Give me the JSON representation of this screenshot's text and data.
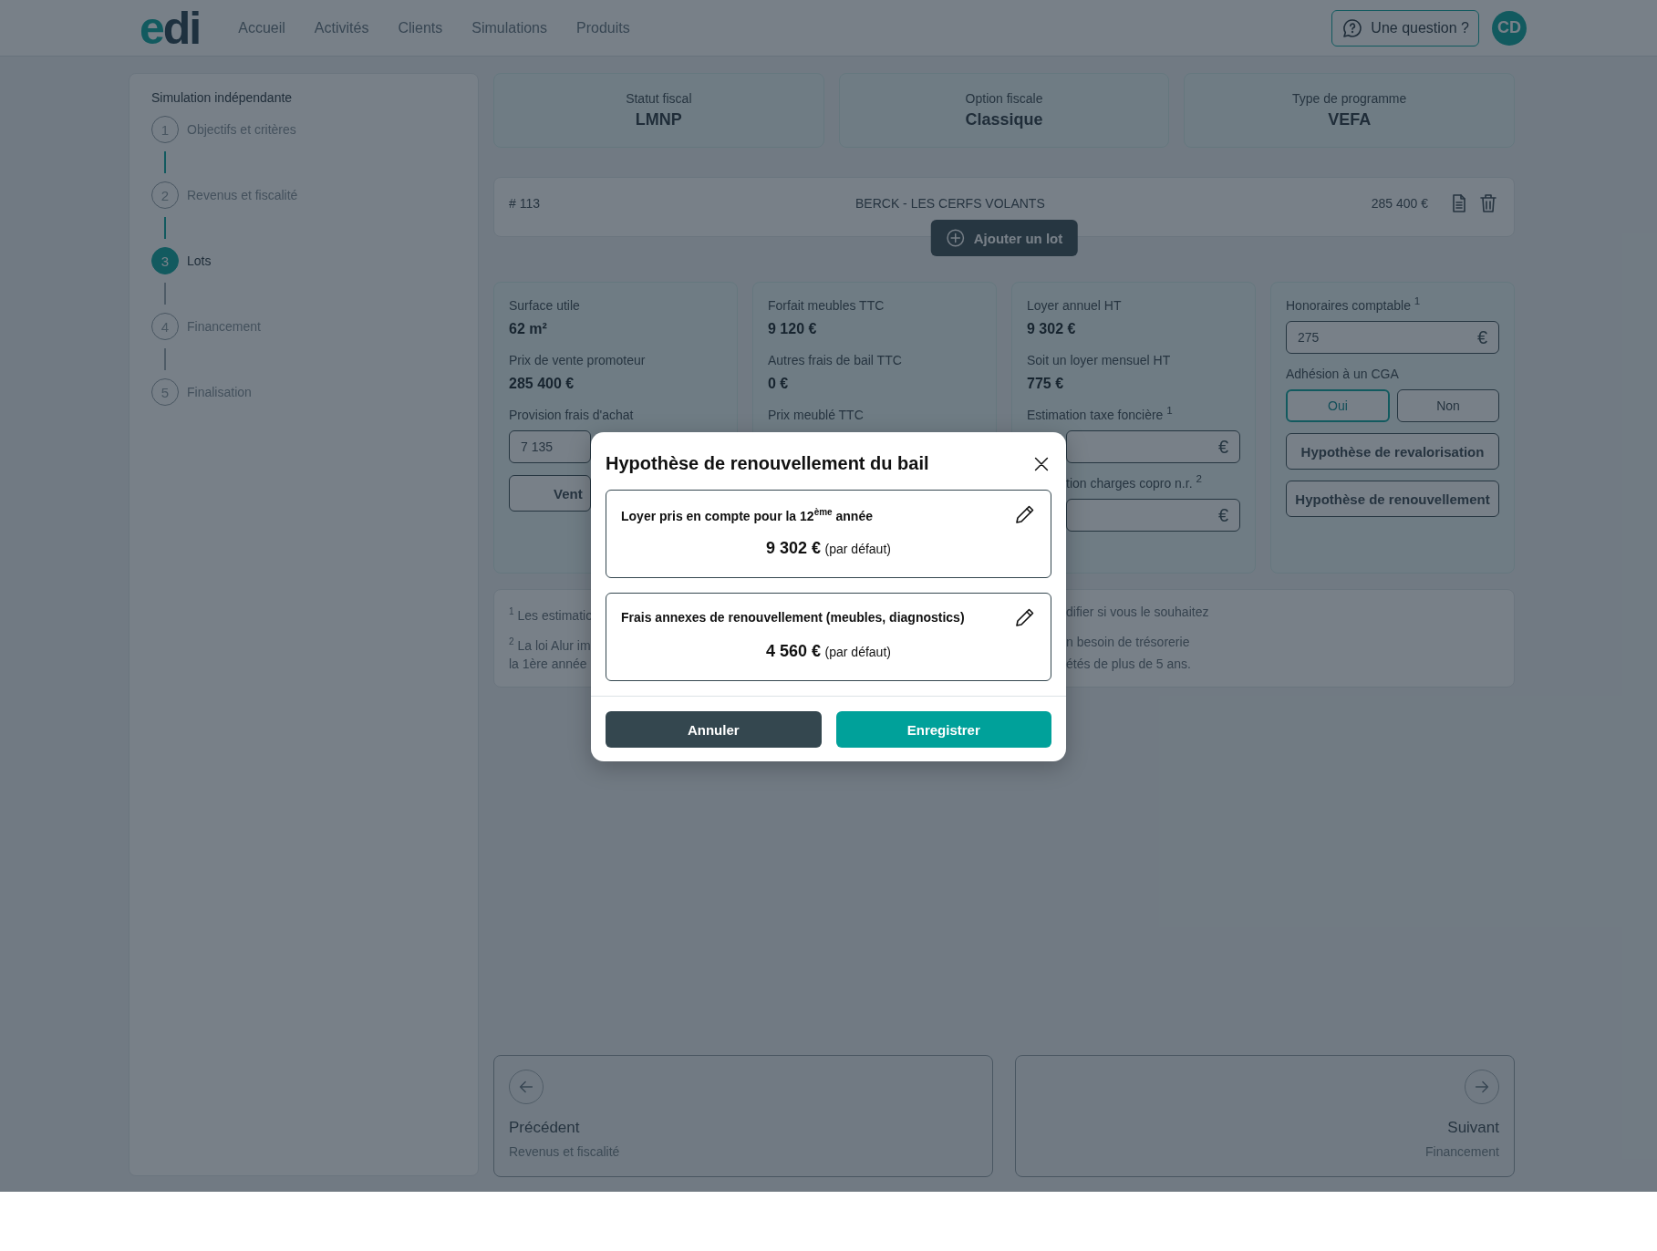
{
  "header": {
    "logo": "edi",
    "nav": [
      "Accueil",
      "Activités",
      "Clients",
      "Simulations",
      "Produits"
    ],
    "help_button": "Une question ?",
    "avatar": "CD"
  },
  "sidebar": {
    "title": "Simulation indépendante",
    "steps": [
      {
        "number": "1",
        "label": "Objectifs et critères",
        "current": false
      },
      {
        "number": "2",
        "label": "Revenus et fiscalité",
        "current": false
      },
      {
        "number": "3",
        "label": "Lots",
        "current": true
      },
      {
        "number": "4",
        "label": "Financement",
        "current": false
      },
      {
        "number": "5",
        "label": "Finalisation",
        "current": false
      }
    ]
  },
  "summary": [
    {
      "label": "Statut fiscal",
      "value": "LMNP"
    },
    {
      "label": "Option fiscale",
      "value": "Classique"
    },
    {
      "label": "Type de programme",
      "value": "VEFA"
    }
  ],
  "lot": {
    "number": "# 113",
    "name": "BERCK - LES CERFS VOLANTS",
    "price": "285 400 €",
    "add_button": "Ajouter un lot"
  },
  "columns": [
    {
      "items": [
        {
          "kind": "stat",
          "label": "Surface utile",
          "value": "62 m²"
        },
        {
          "kind": "stat",
          "label": "Prix de vente promoteur",
          "value": "285 400 €"
        },
        {
          "kind": "field-cut-right",
          "label": "Provision frais d'achat",
          "value": "7 135"
        },
        {
          "kind": "button-cut-right",
          "label": "Vent"
        }
      ]
    },
    {
      "items": [
        {
          "kind": "stat",
          "label": "Forfait meubles TTC",
          "value": "9 120 €"
        },
        {
          "kind": "stat",
          "label": "Autres frais de bail TTC",
          "value": "0 €"
        },
        {
          "kind": "label",
          "label": "Prix meublé TTC"
        }
      ]
    },
    {
      "items": [
        {
          "kind": "stat",
          "label": "Loyer annuel HT",
          "value": "9 302 €"
        },
        {
          "kind": "stat",
          "label": "Soit un loyer mensuel HT",
          "value": "775 €"
        },
        {
          "kind": "field-cut-left",
          "label": "Estimation taxe foncière $^{1}$",
          "unit": "€"
        },
        {
          "kind": "field-cut-both",
          "label": "tion charges copro n.r. $^{2}$",
          "unit": "€"
        }
      ]
    },
    {
      "items": [
        {
          "kind": "field",
          "label": "Honoraires comptable $^{1}$",
          "value": "275",
          "unit": "€"
        },
        {
          "kind": "toggle",
          "label": "Adhésion à un CGA",
          "options": [
            {
              "label": "Oui",
              "selected": true
            },
            {
              "label": "Non",
              "selected": false
            }
          ]
        },
        {
          "kind": "button",
          "label": "Hypothèse de revalorisation"
        },
        {
          "kind": "button",
          "label": "Hypothèse de renouvellement"
        }
      ]
    }
  ],
  "notes": [
    {
      "left": "$^{1}$ Les estimatio",
      "right": "difier si vous le souhaitez"
    },
    {
      "left": "$^{2}$ La loi Alur im",
      "right": "n besoin de trésorerie"
    },
    {
      "left": "la 1ère année",
      "right": "étés de plus de 5 ans."
    }
  ],
  "navigation": {
    "previous": {
      "title": "Précédent",
      "subtitle": "Revenus et fiscalité"
    },
    "next": {
      "title": "Suivant",
      "subtitle": "Financement"
    }
  },
  "modal": {
    "title": "Hypothèse de renouvellement du bail",
    "items": [
      {
        "label": "Loyer pris en compte pour la 12$^{ème}$ année",
        "value": "9 302 €",
        "note": "(par défaut)"
      },
      {
        "label": "Frais annexes de renouvellement (meubles, diagnostics)",
        "value": "4 560 €",
        "note": "(par défaut)"
      }
    ],
    "cancel_button": "Annuler",
    "save_button": "Enregistrer"
  }
}
